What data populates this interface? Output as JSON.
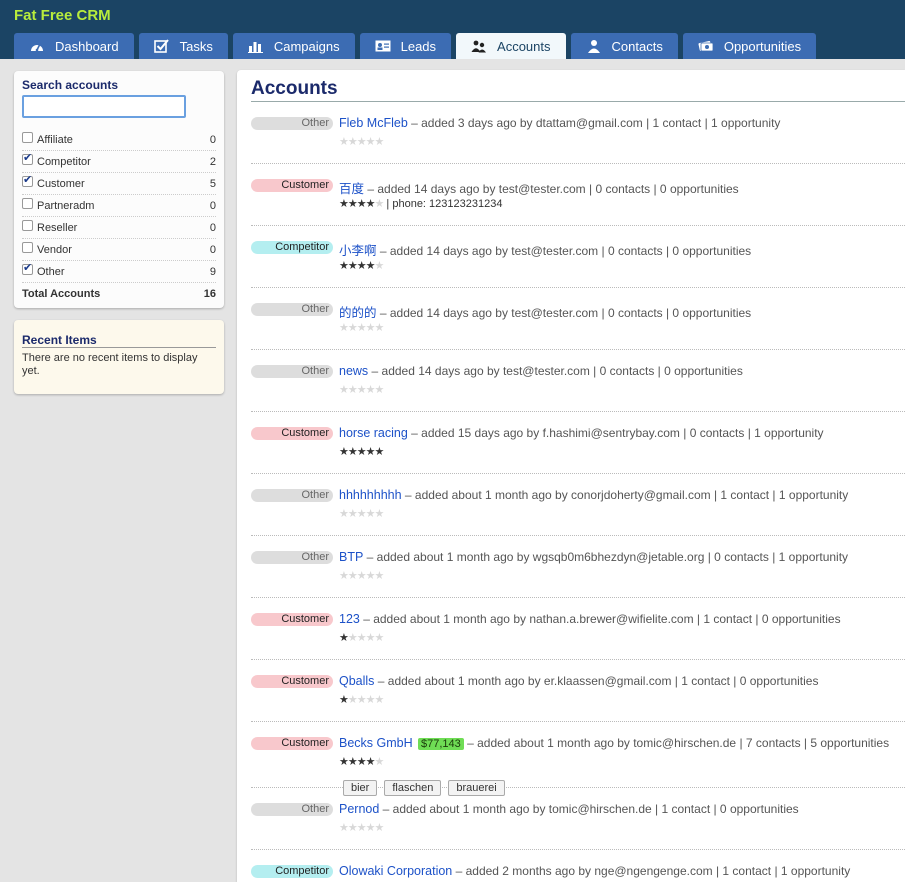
{
  "app": {
    "brand": "Fat Free CRM"
  },
  "tabs": [
    {
      "label": "Dashboard",
      "icon": "dashboard-icon",
      "active": false
    },
    {
      "label": "Tasks",
      "icon": "tasks-icon",
      "active": false
    },
    {
      "label": "Campaigns",
      "icon": "campaigns-icon",
      "active": false
    },
    {
      "label": "Leads",
      "icon": "leads-icon",
      "active": false
    },
    {
      "label": "Accounts",
      "icon": "accounts-icon",
      "active": true
    },
    {
      "label": "Contacts",
      "icon": "contacts-icon",
      "active": false
    },
    {
      "label": "Opportunities",
      "icon": "opportunities-icon",
      "active": false
    }
  ],
  "sidebar": {
    "search_title": "Search accounts",
    "search_value": "",
    "filters": [
      {
        "label": "Affiliate",
        "count": "0",
        "checked": false
      },
      {
        "label": "Competitor",
        "count": "2",
        "checked": true
      },
      {
        "label": "Customer",
        "count": "5",
        "checked": true
      },
      {
        "label": "Partneradm",
        "count": "0",
        "checked": false
      },
      {
        "label": "Reseller",
        "count": "0",
        "checked": false
      },
      {
        "label": "Vendor",
        "count": "0",
        "checked": false
      },
      {
        "label": "Other",
        "count": "9",
        "checked": true
      }
    ],
    "total_label": "Total Accounts",
    "total_count": "16",
    "recent_title": "Recent Items",
    "recent_text": "There are no recent items to display yet."
  },
  "main": {
    "title": "Accounts",
    "accounts": [
      {
        "category": "Other",
        "name": "Fleb McFleb",
        "info": " – added 3 days ago by dtattam@gmail.com | 1 contact | 1 opportunity",
        "rating": 0,
        "extra": "",
        "amount": "",
        "tags": []
      },
      {
        "category": "Customer",
        "name": "百度",
        "info": " – added 14 days ago by test@tester.com | 0 contacts | 0 opportunities",
        "rating": 4,
        "extra": " | phone: 123123231234",
        "amount": "",
        "tags": []
      },
      {
        "category": "Competitor",
        "name": "小李啊",
        "info": " – added 14 days ago by test@tester.com | 0 contacts | 0 opportunities",
        "rating": 4,
        "extra": "",
        "amount": "",
        "tags": []
      },
      {
        "category": "Other",
        "name": "的的的",
        "info": " – added 14 days ago by test@tester.com | 0 contacts | 0 opportunities",
        "rating": 0,
        "extra": "",
        "amount": "",
        "tags": []
      },
      {
        "category": "Other",
        "name": "news",
        "info": " – added 14 days ago by test@tester.com | 0 contacts | 0 opportunities",
        "rating": 0,
        "extra": "",
        "amount": "",
        "tags": []
      },
      {
        "category": "Customer",
        "name": "horse racing",
        "info": " – added 15 days ago by f.hashimi@sentrybay.com | 0 contacts | 1 opportunity",
        "rating": 5,
        "extra": "",
        "amount": "",
        "tags": []
      },
      {
        "category": "Other",
        "name": "hhhhhhhhh",
        "info": " – added about 1 month ago by conorjdoherty@gmail.com | 1 contact | 1 opportunity",
        "rating": 0,
        "extra": "",
        "amount": "",
        "tags": []
      },
      {
        "category": "Other",
        "name": "BTP",
        "info": " – added about 1 month ago by wgsqb0m6bhezdyn@jetable.org | 0 contacts | 1 opportunity",
        "rating": 0,
        "extra": "",
        "amount": "",
        "tags": []
      },
      {
        "category": "Customer",
        "name": "123",
        "info": " – added about 1 month ago by nathan.a.brewer@wifielite.com | 1 contact | 0 opportunities",
        "rating": 1,
        "extra": "",
        "amount": "",
        "tags": []
      },
      {
        "category": "Customer",
        "name": "Qballs",
        "info": " – added about 1 month ago by er.klaassen@gmail.com | 1 contact | 0 opportunities",
        "rating": 1,
        "extra": "",
        "amount": "",
        "tags": []
      },
      {
        "category": "Customer",
        "name": "Becks GmbH",
        "info": " – added about 1 month ago by tomic@hirschen.de | 7 contacts | 5 opportunities",
        "rating": 4,
        "extra": "",
        "amount": "$77,143",
        "tags": [
          "bier",
          "flaschen",
          "brauerei"
        ]
      },
      {
        "category": "Other",
        "name": "Pernod",
        "info": " – added about 1 month ago by tomic@hirschen.de | 1 contact | 0 opportunities",
        "rating": 0,
        "extra": "",
        "amount": "",
        "tags": []
      },
      {
        "category": "Competitor",
        "name": "Olowaki Corporation",
        "info": " – added 2 months ago by nge@ngengenge.com | 1 contact | 1 opportunity",
        "rating": 0,
        "extra": "",
        "amount": "",
        "tags": []
      }
    ]
  },
  "colors": {
    "header_bg": "#1b4464",
    "brand": "#b8ec3c",
    "tab_bg": "#3c6cb3",
    "link": "#1d52c8",
    "badge_other": "#dddddd",
    "badge_customer": "#f8c8cc",
    "badge_competitor": "#b4eef0",
    "amount_bg": "#6fdd55"
  }
}
